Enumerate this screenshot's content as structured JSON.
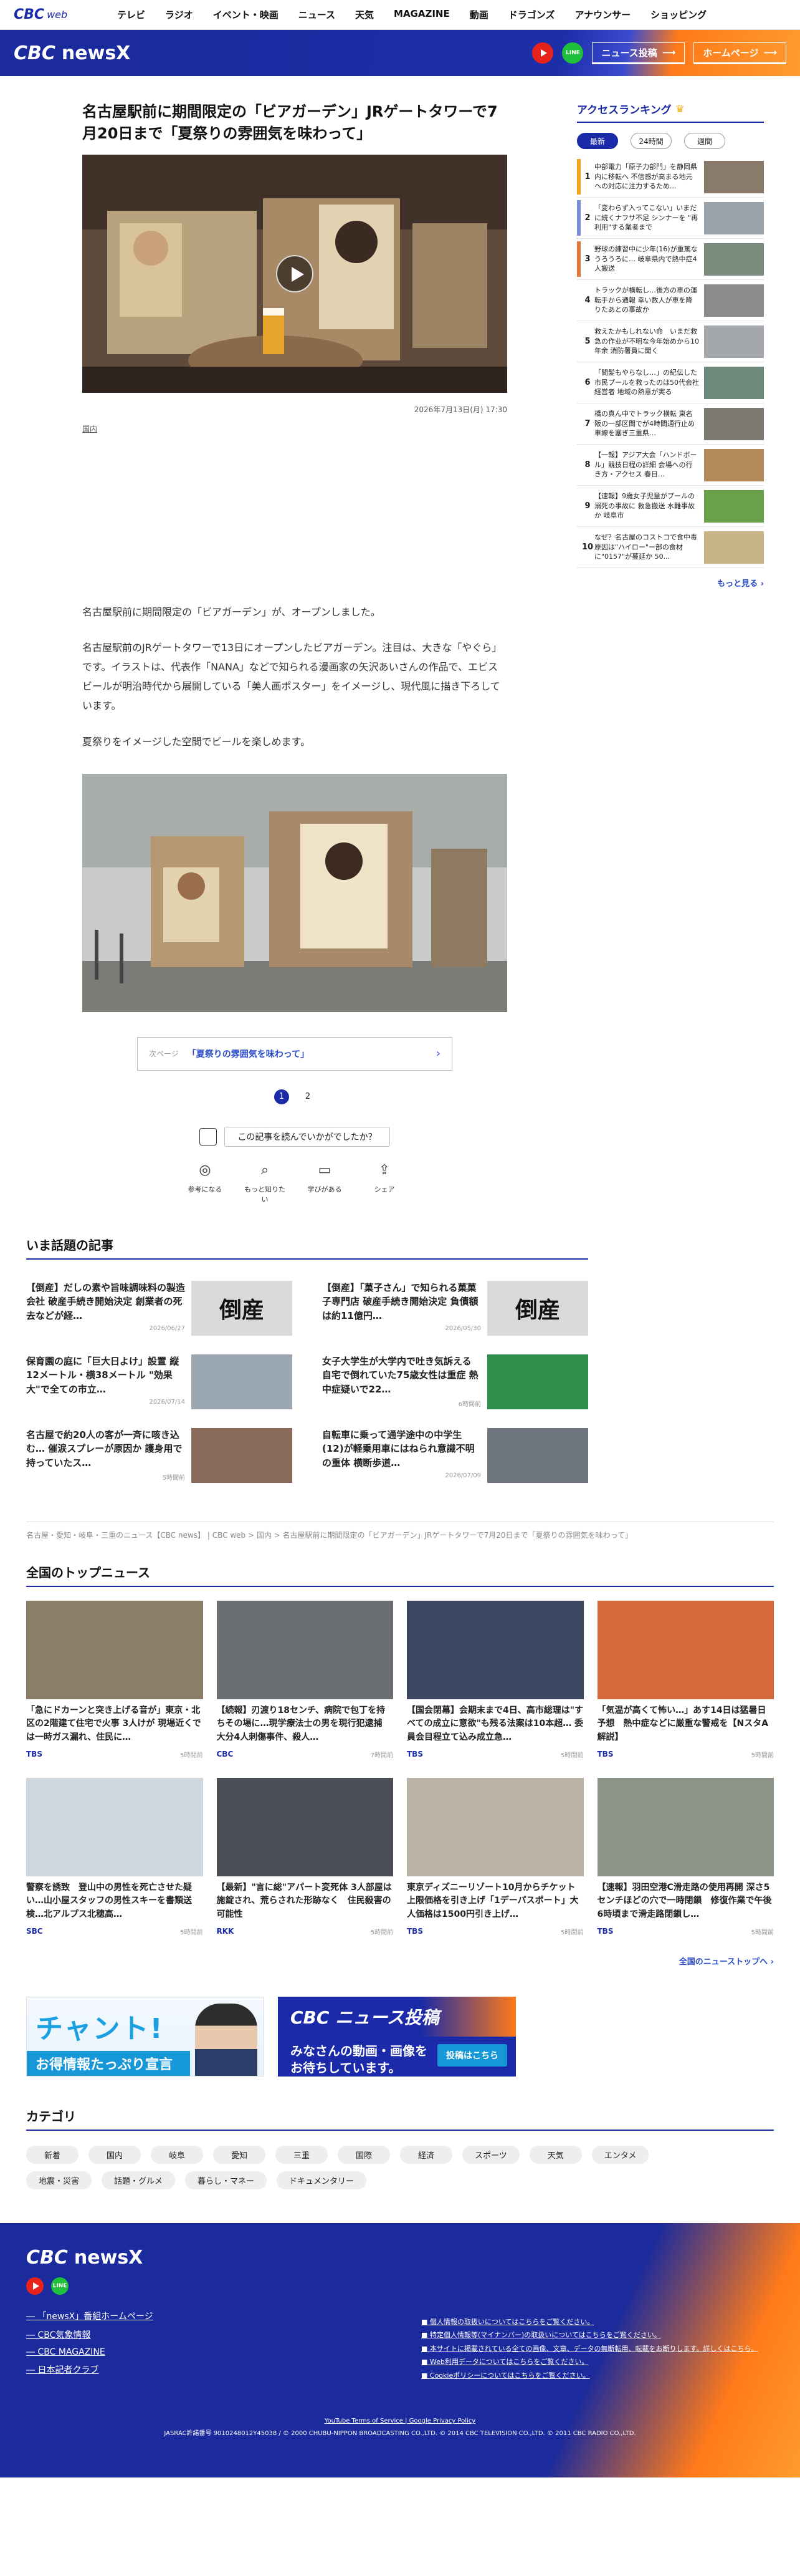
{
  "gnav": {
    "logo": "CBC",
    "logo_suffix": "web",
    "items": [
      "テレビ",
      "ラジオ",
      "イベント・映画",
      "ニュース",
      "天気",
      "MAGAZINE",
      "動画",
      "ドラゴンズ",
      "アナウンサー",
      "ショッピング"
    ]
  },
  "header": {
    "logo_cbc": "CBC",
    "logo_news": "newsX",
    "line_label": "LINE",
    "post_label": "ニュース投稿",
    "home_label": "ホームページ"
  },
  "article": {
    "title": "名古屋駅前に期間限定の「ビアガーデン」JRゲートタワーで7月20日まで「夏祭りの雰囲気を味わって」",
    "date": "2026年7月13日(月) 17:30",
    "category": "国内",
    "paragraphs": [
      "名古屋駅前に期間限定の「ビアガーデン」が、オープンしました。",
      "名古屋駅前のJRゲートタワーで13日にオープンしたビアガーデン。注目は、大きな「やぐら」です。イラストは、代表作「NANA」などで知られる漫画家の矢沢あいさんの作品で、エビスビールが明治時代から展開している「美人画ポスター」をイメージし、現代風に描き下ろしています。",
      "夏祭りをイメージした空間でビールを楽しめます。"
    ],
    "next_label": "次ページ",
    "next_title": "「夏祭りの雰囲気を味わって」",
    "pages": [
      "1",
      "2"
    ],
    "reaction_question": "この記事を読んでいかがでしたか？",
    "reactions": [
      "参考になる",
      "もっと知りたい",
      "学びがある",
      "シェア"
    ]
  },
  "ranking": {
    "title": "アクセスランキング",
    "tabs": [
      "最新",
      "24時間",
      "週間"
    ],
    "items": [
      {
        "rank": "1",
        "text": "中部電力「原子力部門」を静岡県内に移転へ 不信感が高まる地元への対応に注力するため...",
        "color": "#f2a21c"
      },
      {
        "rank": "2",
        "text": "「変わらず入ってこない」いまだに続くナフサ不足 シンナーを \"再利用\"する業者まで",
        "color": "#7c8fd6"
      },
      {
        "rank": "3",
        "text": "野球の練習中に少年(16)が重篤なうろうろに… 岐阜県内で熱中症4人搬送",
        "color": "#e07a3c"
      },
      {
        "rank": "4",
        "text": "トラックが横転し…後方の車の運転手から通報 幸い数人が車を降りたあとの事故か",
        "color": ""
      },
      {
        "rank": "5",
        "text": "救えたかもしれない命　いまだ救急の作业が不明な今年始めから10年余 消防署員に聞く",
        "color": ""
      },
      {
        "rank": "6",
        "text": "「間髪もやらなし…」の紀伝した市民プールを救ったのは50代会社経営者 地域の熱意が実る",
        "color": ""
      },
      {
        "rank": "7",
        "text": "橋の真ん中でトラック横転 東名阪の一部区間でが4時間通行止め 車線を塞ぎ三重県…",
        "color": ""
      },
      {
        "rank": "8",
        "text": "【一報】アジア大会「ハンドボール」競技日程の詳細 会場への行き方・アクセス 春日…",
        "color": ""
      },
      {
        "rank": "9",
        "text": "【速報】9歳女子児童がプールの溺死の事故に 救急搬送 水難事故か 岐阜市",
        "color": ""
      },
      {
        "rank": "10",
        "text": "なぜ？名古屋のコストコで食中毒 原因は\"ハイロー\"ー部の食材に\"0157\"が蔓延か 50...",
        "color": ""
      }
    ],
    "more": "もっと見る"
  },
  "trending": {
    "title": "いま話題の記事",
    "items": [
      {
        "text": "【倒産】だしの素や旨味調味料の製造会社 破産手続き開始決定 創業者の死去などが経…",
        "date": "2026/06/27",
        "img": "倒産"
      },
      {
        "text": "【倒産】「菓子さん」で知られる菓菓子専門店 破産手続き開始決定 負債額は約11億円…",
        "date": "2026/05/30",
        "img": "倒産"
      },
      {
        "text": "保育園の庭に「巨大日よけ」設置 縦12メートル・横38メートル \"効果大\"で全ての市立…",
        "date": "2026/07/14",
        "img": ""
      },
      {
        "text": "女子大学生が大学内で吐き気訴える 自宅で倒れていた75歳女性は重症 熱中症疑いで22…",
        "date": "6時間前",
        "img": ""
      },
      {
        "text": "名古屋で約20人の客が一斉に咳き込む… 催涙スプレーが原因か 護身用で持っていたス…",
        "date": "5時間前",
        "img": ""
      },
      {
        "text": "自転車に乗って通学途中の中学生(12)が軽乗用車にはねられ意識不明の重体 横断歩道…",
        "date": "2026/07/09",
        "img": ""
      }
    ]
  },
  "breadcrumb": "名古屋・愛知・岐阜・三重のニュース【CBC news】 | CBC web > 国内 > 名古屋駅前に期間限定の「ビアガーデン」JRゲートタワーで7月20日まで「夏祭りの雰囲気を味わって」",
  "national": {
    "title": "全国のトップニュース",
    "items": [
      {
        "text": "「急にドカーンと突き上げる音が」東京・北区の2階建て住宅で火事 3人けが 現場近くでは一時ガス漏れ、住民に…",
        "src": "TBS",
        "date": "5時間前",
        "tone": "#8c7c6a"
      },
      {
        "text": "【続報】刃渡り18センチ、病院で包丁を持ちその場に…現学療法士の男を現行犯逮捕　大分4人刺傷事件、殺人…",
        "src": "CBC",
        "date": "7時間前",
        "tone": "#6a6f74"
      },
      {
        "text": "【国会閉幕】会期末まで4日、高市総理は\"すべての成立に意欲\"も残る法案は10本超… 委員会目程立て込み成立急…",
        "src": "TBS",
        "date": "5時間前",
        "tone": "#3d4660"
      },
      {
        "text": "「気温が高くて怖い…」あす14日は猛暑日予想　熱中症などに厳重な警戒を【NスタA解説】",
        "src": "TBS",
        "date": "5時間前",
        "tone": "#d46a3a"
      },
      {
        "text": "警察を誘致　登山中の男性を死亡させた疑い…山小屋スタッフの男性スキーを書類送検…北アルプス北穂高…",
        "src": "SBC",
        "date": "5時間前",
        "tone": "#cfd6de"
      },
      {
        "text": "【最新】\"言に総\"アパート変死体 3人部屋は施錠され、荒らされた形跡なく　住民殺害の可能性",
        "src": "RKK",
        "date": "5時間前",
        "tone": "#4a4f55"
      },
      {
        "text": "東京ディズニーリゾート10月からチケット上限価格を引き上げ「1デーパスポート」大人価格は1500円引き上げ…",
        "src": "TBS",
        "date": "5時間前",
        "tone": "#b8b3a6"
      },
      {
        "text": "【速報】羽田空港C滑走路の使用再開 深さ5センチほどの穴で一時閉鎖　修復作業で午後6時頃まで滑走路閉鎖し…",
        "src": "TBS",
        "date": "5時間前",
        "tone": "#8c9488"
      }
    ],
    "more": "全国のニューストップへ"
  },
  "banners": {
    "chant_title": "チャント!",
    "chant_sub": "お得情報たっぷり宣言",
    "post_title": "CBC ニュース投稿",
    "post_body": "みなさんの動画・画像を\nお待ちしています。",
    "post_btn": "投稿はこちら"
  },
  "categories": {
    "title": "カテゴリ",
    "items": [
      "新着",
      "国内",
      "岐阜",
      "愛知",
      "三重",
      "国際",
      "経済",
      "スポーツ",
      "天気",
      "エンタメ",
      "地震・災害",
      "話題・グルメ",
      "暮らし・マネー",
      "ドキュメンタリー"
    ]
  },
  "footer": {
    "links": [
      "「newsX」番組ホームページ",
      "CBC気象情報",
      "CBC MAGAZINE",
      "日本記者クラブ"
    ],
    "policies": [
      "個人情報の取扱いについてはこちらをご覧ください。",
      "特定個人情報等(マイナンバー)の取扱いについてはこちらをご覧ください。",
      "本サイトに掲載されている全ての画像、文章、データの無断転用、転載をお断りします。詳しくはこちら。",
      "Web利用データについてはこちらをご覧ください。",
      "Cookieポリシーについてはこちらをご覧ください。"
    ],
    "policy_links": "YouTube Terms of Service | Google Privacy Policy",
    "copyright": "JASRAC許諾番号 9010248012Y45038 / © 2000 CHUBU-NIPPON BROADCASTING CO.,LTD. © 2014 CBC TELEVISION CO.,LTD. © 2011 CBC RADIO CO.,LTD."
  }
}
